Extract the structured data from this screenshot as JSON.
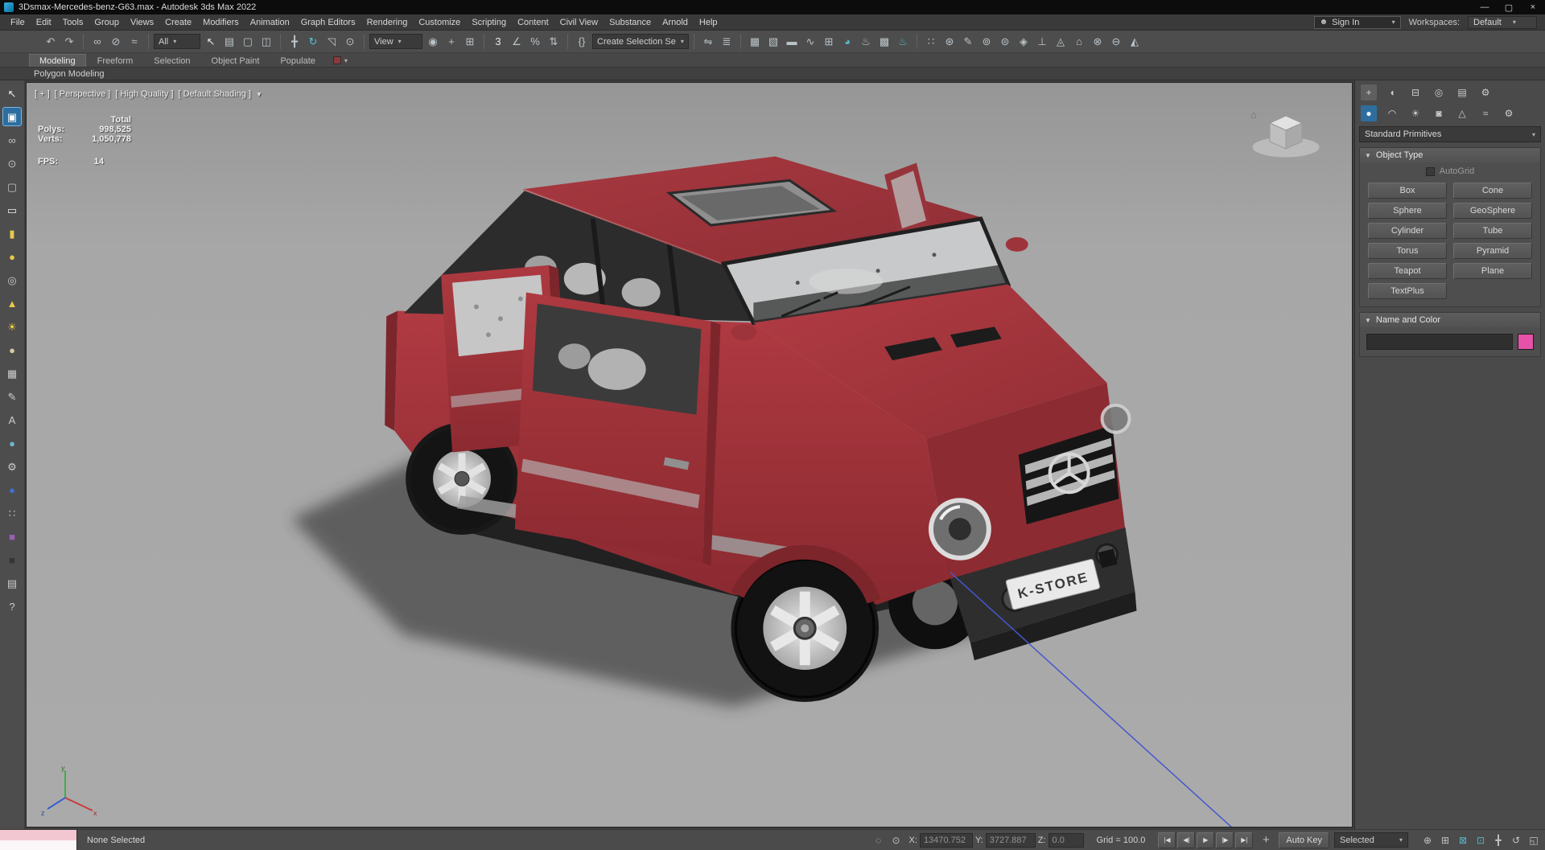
{
  "colors": {
    "accent-blue": "#2d6e9e",
    "object-color": "#e552a8"
  },
  "titlebar": {
    "title": "3Dsmax-Mercedes-benz-G63.max - Autodesk 3ds Max 2022"
  },
  "glyphs": {
    "minimize": "—",
    "maximize": "▢",
    "close": "×",
    "caret": "▾",
    "person": "☻",
    "filter": "▼",
    "rollout_open": "▼"
  },
  "menubar": {
    "items": [
      "File",
      "Edit",
      "Tools",
      "Group",
      "Views",
      "Create",
      "Modifiers",
      "Animation",
      "Graph Editors",
      "Rendering",
      "Customize",
      "Scripting",
      "Content",
      "Civil View",
      "Substance",
      "Arnold",
      "Help"
    ],
    "sign_in": "Sign In",
    "workspaces_label": "Workspaces:",
    "workspaces_value": "Default"
  },
  "toolbar": {
    "selection_filter": "All",
    "ref_coord": "View",
    "selection_set_value": "Create Selection Se",
    "groups": {
      "history": [
        {
          "name": "undo-icon",
          "glyph": "↶"
        },
        {
          "name": "redo-icon",
          "glyph": "↷"
        }
      ],
      "linking": [
        {
          "name": "select-and-link-icon",
          "glyph": "∞"
        },
        {
          "name": "unlink-selection-icon",
          "glyph": "⊘"
        },
        {
          "name": "bind-to-spacewarp-icon",
          "glyph": "≈"
        }
      ],
      "selection": [
        {
          "name": "select-object-icon",
          "glyph": "↖",
          "tint": "#e2e8eb"
        },
        {
          "name": "select-by-name-icon",
          "glyph": "▤"
        },
        {
          "name": "rectangular-selection-icon",
          "glyph": "▢"
        },
        {
          "name": "window-crossing-icon",
          "glyph": "◫"
        }
      ],
      "transform": [
        {
          "name": "select-move-icon",
          "glyph": "╋"
        },
        {
          "name": "select-rotate-icon",
          "glyph": "↻",
          "tint": "#4fc3d9"
        },
        {
          "name": "select-scale-icon",
          "glyph": "◹"
        },
        {
          "name": "select-place-icon",
          "glyph": "⊙"
        }
      ],
      "pivot": [
        {
          "name": "use-pivot-center-icon",
          "glyph": "◉"
        },
        {
          "name": "select-manipulate-icon",
          "glyph": "+"
        },
        {
          "name": "keyboard-override-icon",
          "glyph": "⊞"
        }
      ],
      "snaps": [
        {
          "name": "snap-toggle-3d-icon",
          "glyph": "3",
          "tint": "#e2e8eb"
        },
        {
          "name": "angle-snap-icon",
          "glyph": "∠"
        },
        {
          "name": "percent-snap-icon",
          "glyph": "%"
        },
        {
          "name": "spinner-snap-icon",
          "glyph": "⇅"
        }
      ],
      "sets": [
        {
          "name": "edit-named-sets-icon",
          "glyph": "{}"
        }
      ],
      "mirror_align": [
        {
          "name": "mirror-icon",
          "glyph": "⇋"
        },
        {
          "name": "align-icon",
          "glyph": "≣"
        }
      ],
      "editors": [
        {
          "name": "scene-explorer-icon",
          "glyph": "▦"
        },
        {
          "name": "layer-explorer-icon",
          "glyph": "▧"
        },
        {
          "name": "ribbon-toggle-icon",
          "glyph": "▬"
        },
        {
          "name": "curve-editor-icon",
          "glyph": "∿"
        },
        {
          "name": "schematic-view-icon",
          "glyph": "⊞"
        },
        {
          "name": "material-editor-icon",
          "glyph": "◕",
          "tint": "#58b6c8"
        },
        {
          "name": "render-setup-icon",
          "glyph": "♨"
        },
        {
          "name": "rendered-frame-icon",
          "glyph": "▩"
        },
        {
          "name": "render-production-icon",
          "glyph": "♨",
          "tint": "#58b6c8"
        }
      ],
      "extras": [
        {
          "glyph": "∷"
        },
        {
          "glyph": "⊛"
        },
        {
          "glyph": "✎"
        },
        {
          "glyph": "⊚"
        },
        {
          "glyph": "⊜"
        },
        {
          "glyph": "◈"
        },
        {
          "glyph": "⊥"
        },
        {
          "glyph": "◬"
        },
        {
          "glyph": "⌂"
        },
        {
          "glyph": "⊗"
        },
        {
          "glyph": "⊖"
        },
        {
          "glyph": "◭"
        }
      ]
    }
  },
  "ribbon": {
    "tabs": [
      {
        "label": "Modeling",
        "active": true
      },
      {
        "label": "Freeform"
      },
      {
        "label": "Selection"
      },
      {
        "label": "Object Paint"
      },
      {
        "label": "Populate"
      }
    ],
    "panel_label": "Polygon Modeling"
  },
  "leftbar": {
    "items": [
      {
        "name": "select-cursor-icon",
        "glyph": "↖",
        "tint": "#ececec"
      },
      {
        "name": "active-tool-icon",
        "glyph": "▣",
        "active": true,
        "tint": "#ffffff"
      },
      {
        "name": "link-tool-icon",
        "glyph": "∞"
      },
      {
        "name": "pick-tool-icon",
        "glyph": "⊙"
      },
      {
        "name": "region-tool-icon",
        "glyph": "▢"
      },
      {
        "name": "plane-primitive-icon",
        "glyph": "▭",
        "tint": "#f0f0f0"
      },
      {
        "name": "cylinder-primitive-icon",
        "glyph": "▮",
        "tint": "#e8c84a"
      },
      {
        "name": "sphere-primitive-icon",
        "glyph": "●",
        "tint": "#e8c84a"
      },
      {
        "name": "torus-primitive-icon",
        "glyph": "◎",
        "tint": "#cccccc"
      },
      {
        "name": "cone-primitive-icon",
        "glyph": "▲",
        "tint": "#e8c84a"
      },
      {
        "name": "light-tool-icon",
        "glyph": "☀",
        "tint": "#f0d040"
      },
      {
        "name": "geosphere-primitive-icon",
        "glyph": "●",
        "tint": "#d8c8a0"
      },
      {
        "name": "checker-map-icon",
        "glyph": "▦",
        "tint": "#cccccc"
      },
      {
        "name": "paint-tool-icon",
        "glyph": "✎",
        "tint": "#cccccc"
      },
      {
        "name": "text-tool-icon",
        "glyph": "A",
        "tint": "#cccccc"
      },
      {
        "name": "material-sphere-icon",
        "glyph": "●",
        "tint": "#6fb3d2"
      },
      {
        "name": "utility-tool-icon",
        "glyph": "⚙",
        "tint": "#cccccc"
      },
      {
        "name": "render-ball-icon",
        "glyph": "●",
        "tint": "#3f6fd0"
      },
      {
        "name": "dots-tool-icon",
        "glyph": "∷",
        "tint": "#cccccc"
      },
      {
        "name": "purple-cube-icon",
        "glyph": "■",
        "tint": "#9a5fb5"
      },
      {
        "name": "dark-cube-icon",
        "glyph": "■",
        "tint": "#353535"
      },
      {
        "name": "document-tool-icon",
        "glyph": "▤",
        "tint": "#cccccc"
      },
      {
        "name": "help-icon",
        "glyph": "?",
        "tint": "#cccccc"
      }
    ]
  },
  "viewport": {
    "label_segments": [
      "[ + ]",
      "[ Perspective ]",
      "[ High Quality ]",
      "[ Default Shading ]"
    ],
    "stats": {
      "total_label": "Total",
      "polys_label": "Polys:",
      "polys_value": "998,525",
      "verts_label": "Verts:",
      "verts_value": "1,050,778",
      "fps_label": "FPS:",
      "fps_value": "14"
    },
    "plate_text": "K-STORE",
    "axis_labels": {
      "x": "x",
      "y": "y",
      "z": "z"
    }
  },
  "command_panel": {
    "tabs": [
      {
        "name": "tab-create",
        "glyph": "+",
        "active": true
      },
      {
        "name": "tab-modify",
        "glyph": "◖"
      },
      {
        "name": "tab-hierarchy",
        "glyph": "⊟"
      },
      {
        "name": "tab-motion",
        "glyph": "◎"
      },
      {
        "name": "tab-display",
        "glyph": "▤"
      },
      {
        "name": "tab-utilities",
        "glyph": "⚙"
      }
    ],
    "categories": [
      {
        "name": "category-geometry",
        "glyph": "●",
        "active": true,
        "tint": "#eaf2f8"
      },
      {
        "name": "category-shapes",
        "glyph": "◠"
      },
      {
        "name": "category-lights",
        "glyph": "☀"
      },
      {
        "name": "category-cameras",
        "glyph": "◙"
      },
      {
        "name": "category-helpers",
        "glyph": "△"
      },
      {
        "name": "category-spacewarps",
        "glyph": "≈"
      },
      {
        "name": "category-systems",
        "glyph": "⚙"
      }
    ],
    "category_select": "Standard Primitives",
    "rollouts": {
      "object_type": {
        "title": "Object Type",
        "autogrid_label": "AutoGrid",
        "buttons": [
          "Box",
          "Cone",
          "Sphere",
          "GeoSphere",
          "Cylinder",
          "Tube",
          "Torus",
          "Pyramid",
          "Teapot",
          "Plane",
          "TextPlus"
        ]
      },
      "name_color": {
        "title": "Name and Color"
      }
    }
  },
  "statusbar": {
    "selection_status": "None Selected",
    "mini_icons": [
      {
        "name": "isolate-selection-icon",
        "glyph": "◌"
      },
      {
        "name": "selection-lock-icon",
        "glyph": "⊙"
      }
    ],
    "coords": {
      "x_label": "X:",
      "x_value": "13470.752",
      "y_label": "Y:",
      "y_value": "3727.887",
      "z_label": "Z:",
      "z_value": "0.0"
    },
    "grid_label": "Grid = 100.0",
    "playback": [
      {
        "name": "go-to-start-button",
        "glyph": "|◀"
      },
      {
        "name": "previous-frame-button",
        "glyph": "◀|"
      },
      {
        "name": "play-button",
        "glyph": "▶"
      },
      {
        "name": "next-frame-button",
        "glyph": "|▶"
      },
      {
        "name": "go-to-end-button",
        "glyph": "▶|"
      }
    ],
    "set_key_glyph": "+",
    "auto_key_label": "Auto Key",
    "key_filter_value": "Selected",
    "nav_icons": [
      {
        "name": "zoom-icon",
        "glyph": "⊕"
      },
      {
        "name": "zoom-all-icon",
        "glyph": "⊞"
      },
      {
        "name": "zoom-extents-icon",
        "glyph": "⊠",
        "tint": "#58b6c8"
      },
      {
        "name": "zoom-extents-all-icon",
        "glyph": "⊡",
        "tint": "#58b6c8"
      },
      {
        "name": "pan-icon",
        "glyph": "╋"
      },
      {
        "name": "orbit-icon",
        "glyph": "↺"
      },
      {
        "name": "maximize-viewport-icon",
        "glyph": "◱"
      }
    ]
  }
}
